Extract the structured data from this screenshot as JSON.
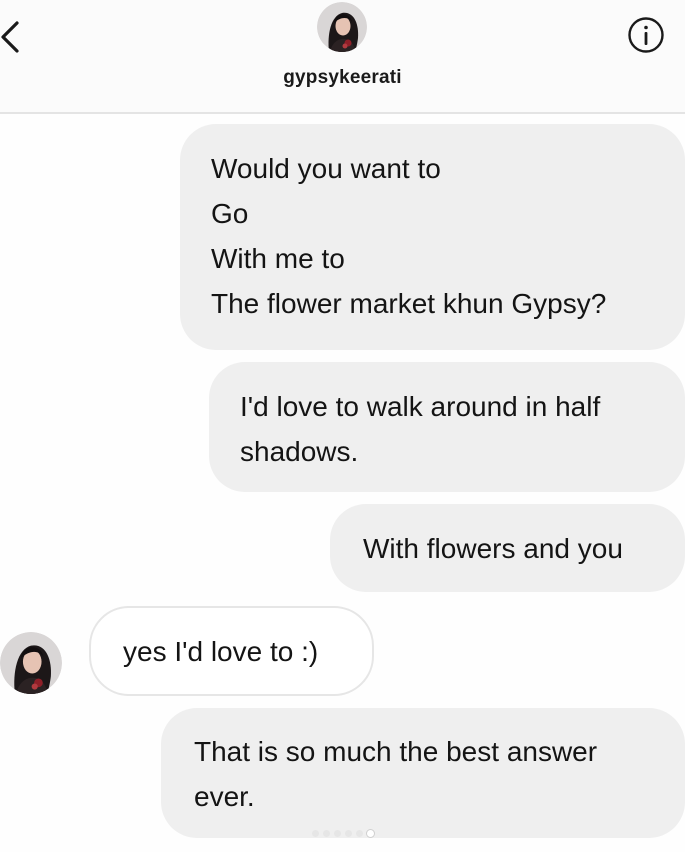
{
  "header": {
    "username": "gypsykeerati",
    "back_icon": "chevron-left-icon",
    "info_icon": "info-icon",
    "avatar_icon": "profile-photo"
  },
  "messages": [
    {
      "direction": "outgoing",
      "lines": [
        "Would you want to",
        "Go",
        "With me to",
        "The flower market khun Gypsy?"
      ]
    },
    {
      "direction": "outgoing",
      "lines": [
        "I'd love to walk around in half",
        "shadows."
      ]
    },
    {
      "direction": "outgoing",
      "lines": [
        "With flowers and you"
      ]
    },
    {
      "direction": "incoming",
      "lines": [
        "yes I'd love to :)"
      ]
    },
    {
      "direction": "outgoing",
      "lines": [
        "That is so much the best answer",
        "ever."
      ]
    }
  ],
  "colors": {
    "outgoing_bubble": "#efefef",
    "incoming_bubble": "#ffffff",
    "incoming_border": "#e6e6e6",
    "text": "#141414"
  }
}
